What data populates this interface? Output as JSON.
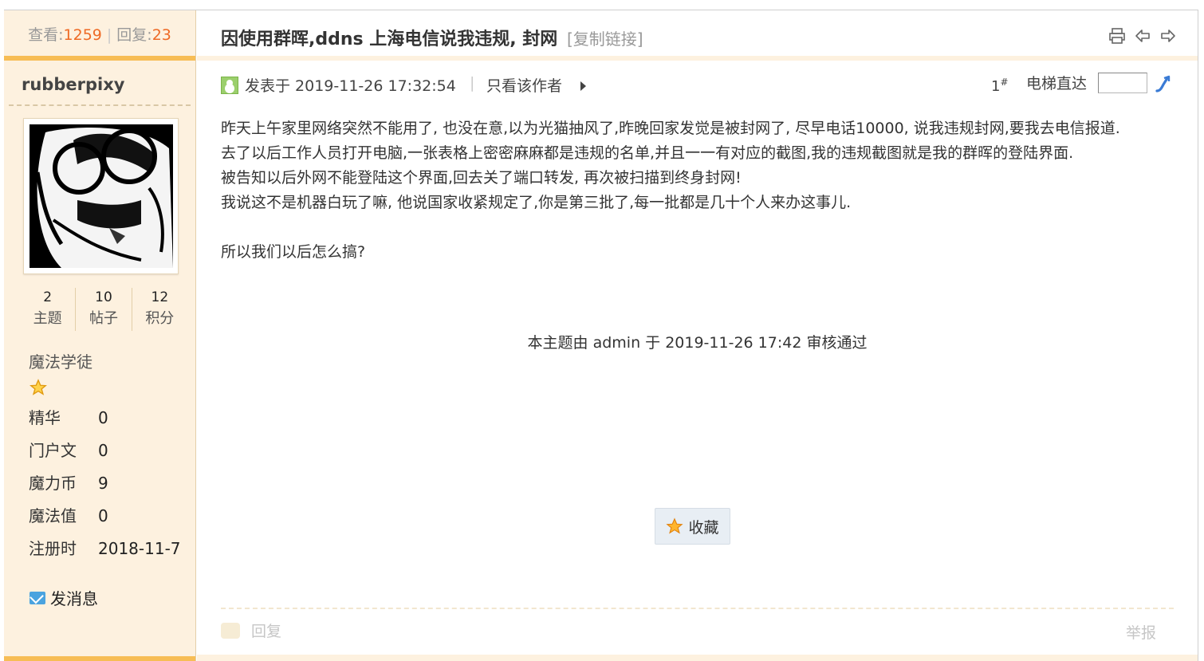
{
  "thread_stats": {
    "views_label": "查看:",
    "views": "1259",
    "sep": "|",
    "replies_label": "回复:",
    "replies": "23"
  },
  "thread": {
    "title": "因使用群晖,ddns 上海电信说我违规, 封网",
    "copy_link": "[复制链接]"
  },
  "author": {
    "name": "rubberpixy",
    "stats": [
      {
        "value": "2",
        "label": "主题"
      },
      {
        "value": "10",
        "label": "帖子"
      },
      {
        "value": "12",
        "label": "积分"
      }
    ],
    "rank": "魔法学徒",
    "info": [
      {
        "key": "精华",
        "value": "0"
      },
      {
        "key": "门户文",
        "value": "0"
      },
      {
        "key": "魔力币",
        "value": "9"
      },
      {
        "key": "魔法值",
        "value": "0"
      },
      {
        "key": "注册时",
        "value": "2018-11-7"
      }
    ],
    "send_message": "发消息"
  },
  "post": {
    "posted_at": "发表于 2019-11-26 17:32:54",
    "pipe": "|",
    "only_author": "只看该作者",
    "floor_number": "1",
    "floor_mark": "#",
    "elevator_label": "电梯直达",
    "elevator_value": "",
    "lines": [
      "昨天上午家里网络突然不能用了, 也没在意,以为光猫抽风了,昨晚回家发觉是被封网了, 尽早电话10000, 说我违规封网,要我去电信报道.",
      "去了以后工作人员打开电脑,一张表格上密密麻麻都是违规的名单,并且一一有对应的截图,我的违规截图就是我的群晖的登陆界面.",
      "被告知以后外网不能登陆这个界面,回去关了端口转发, 再次被扫描到终身封网!",
      "我说这不是机器白玩了嘛, 他说国家收紧规定了,你是第三批了,每一批都是几十个人来办这事儿.",
      "所以我们以后怎么搞?"
    ],
    "audit_note": "本主题由 admin 于 2019-11-26 17:42 审核通过",
    "favorite_label": "收藏",
    "reply_label": "回复",
    "report_label": "举报"
  },
  "icons": {
    "print": "print-icon",
    "prev": "prev-thread-icon",
    "next": "next-thread-icon",
    "online": "online-status-icon",
    "go": "go-floor-icon",
    "star": "rank-star-icon",
    "mail": "mail-icon",
    "favorite": "favorite-star-icon",
    "reply": "reply-icon"
  },
  "colors": {
    "accent_orange": "#ee6a25",
    "sidebar_bg": "#fdf1df",
    "sidebar_border": "#f7bd55",
    "link_blue": "#3a7bd5"
  }
}
